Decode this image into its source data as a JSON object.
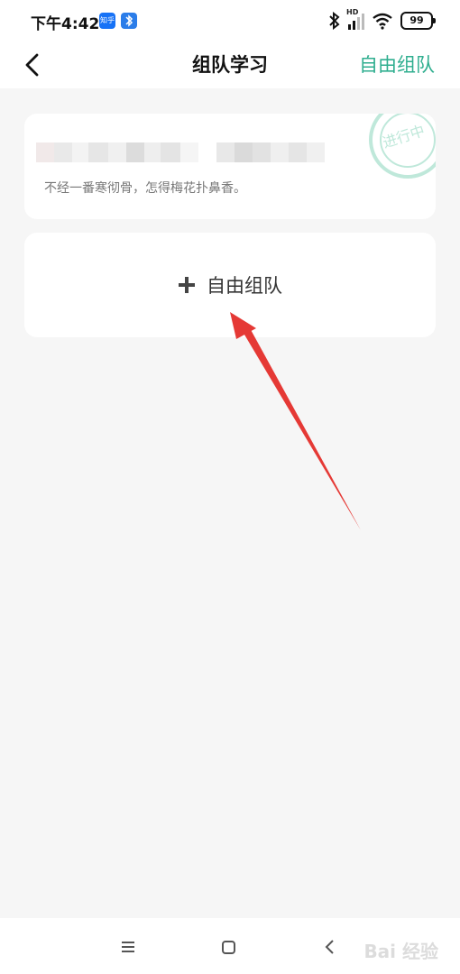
{
  "status_bar": {
    "time": "下午4:42",
    "app_icon_label": "知乎",
    "battery": "99",
    "hd_label": "HD"
  },
  "header": {
    "title": "组队学习",
    "action_label": "自由组队"
  },
  "team_card": {
    "quote": "不经一番寒彻骨，怎得梅花扑鼻香。",
    "stamp_text": "进行中"
  },
  "add_card": {
    "label": "自由组队"
  },
  "watermark": "Bai 经验",
  "colors": {
    "accent": "#2fae8f",
    "background": "#f6f6f6",
    "card": "#ffffff",
    "annotation_arrow": "#e53935",
    "stamp": "#bfe8da"
  }
}
